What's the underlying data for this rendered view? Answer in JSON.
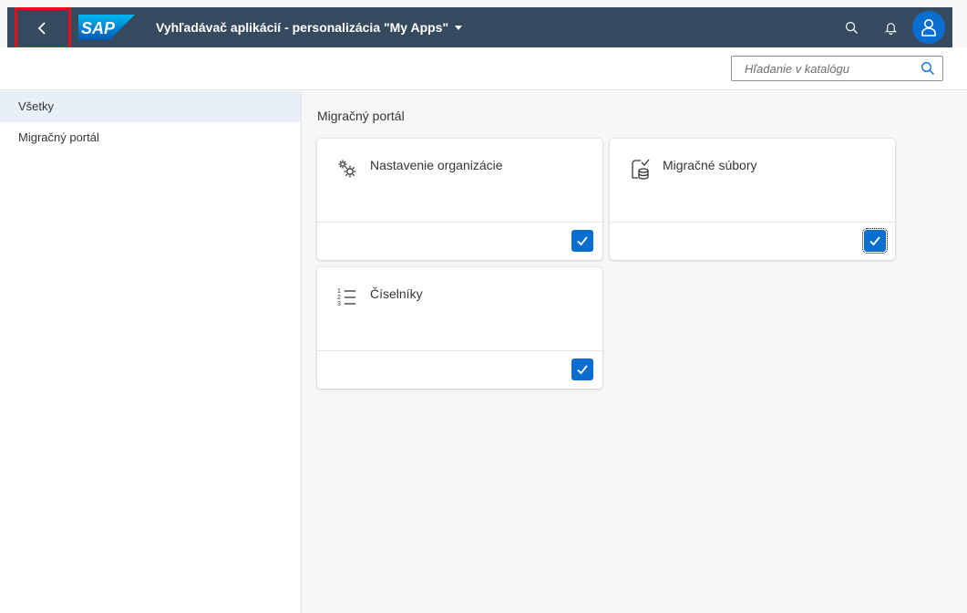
{
  "header": {
    "logo_text": "SAP",
    "title": "Vyhľadávač aplikácií - personalizácia \"My Apps\""
  },
  "search": {
    "placeholder": "Hľadanie v katalógu",
    "value": ""
  },
  "sidebar": {
    "items": [
      {
        "label": "Všetky",
        "selected": true
      },
      {
        "label": "Migračný portál",
        "selected": false
      }
    ]
  },
  "main": {
    "group_title": "Migračný portál",
    "tiles": [
      {
        "label": "Nastavenie organizácie",
        "icon": "settings-icon",
        "checked": true
      },
      {
        "label": "Migračné súbory",
        "icon": "migration-files-icon",
        "checked": true
      },
      {
        "label": "Číselníky",
        "icon": "numbered-list-icon",
        "checked": true
      }
    ]
  },
  "colors": {
    "shell_bg": "#354a5f",
    "accent": "#0a6ed1",
    "highlight_border": "#e4111d"
  }
}
